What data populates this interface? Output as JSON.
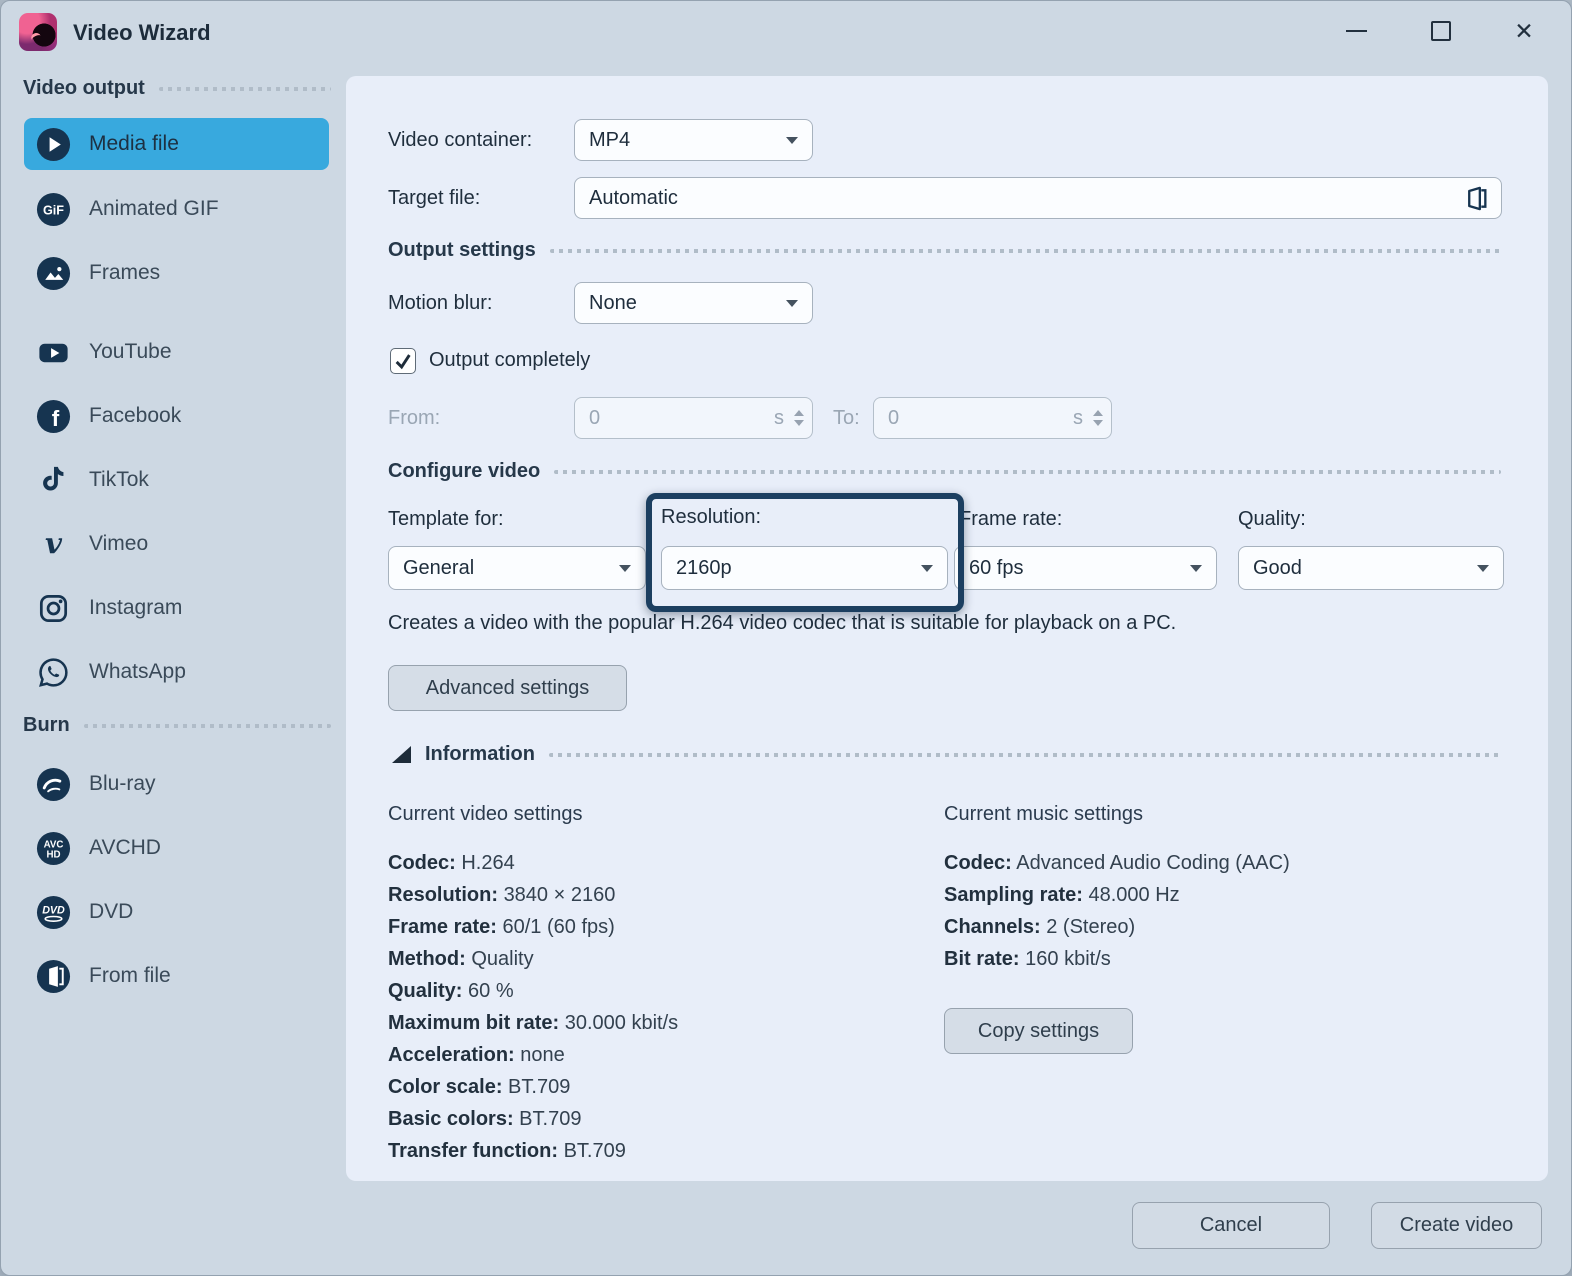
{
  "window": {
    "title": "Video Wizard",
    "controls": {
      "minimize": "minimize",
      "maximize": "maximize",
      "close": "✕"
    }
  },
  "colors": {
    "accent": "#38a9de",
    "icon_navy": "#163450",
    "highlight_border": "#1c3f60",
    "panel_bg": "#e8eef9",
    "window_bg": "#cdd8e3"
  },
  "sidebar": {
    "video_output_label": "Video output",
    "burn_label": "Burn",
    "items": [
      {
        "label": "Media file",
        "icon": "play-circle-icon",
        "selected": true
      },
      {
        "label": "Animated GIF",
        "icon": "gif-icon"
      },
      {
        "label": "Frames",
        "icon": "frames-icon"
      },
      {
        "label": "YouTube",
        "icon": "youtube-icon"
      },
      {
        "label": "Facebook",
        "icon": "facebook-icon"
      },
      {
        "label": "TikTok",
        "icon": "tiktok-icon"
      },
      {
        "label": "Vimeo",
        "icon": "vimeo-icon"
      },
      {
        "label": "Instagram",
        "icon": "instagram-icon"
      },
      {
        "label": "WhatsApp",
        "icon": "whatsapp-icon"
      },
      {
        "label": "Blu-ray",
        "icon": "bluray-icon"
      },
      {
        "label": "AVCHD",
        "icon": "avchd-icon"
      },
      {
        "label": "DVD",
        "icon": "dvd-icon"
      },
      {
        "label": "From file",
        "icon": "from-file-icon"
      }
    ]
  },
  "form": {
    "video_container_label": "Video container:",
    "video_container_value": "MP4",
    "target_file_label": "Target file:",
    "target_file_value": "Automatic",
    "output_settings_label": "Output settings",
    "motion_blur_label": "Motion blur:",
    "motion_blur_value": "None",
    "output_completely_label": "Output completely",
    "output_completely_checked": true,
    "from_label": "From:",
    "from_value": "0",
    "from_unit": "s",
    "to_label": "To:",
    "to_value": "0",
    "to_unit": "s",
    "configure_video_label": "Configure video",
    "template_label": "Template for:",
    "template_value": "General",
    "resolution_label": "Resolution:",
    "resolution_value": "2160p",
    "frame_rate_label": "Frame rate:",
    "frame_rate_value": "60 fps",
    "quality_label": "Quality:",
    "quality_value": "Good",
    "description": "Creates a video with the popular H.264 video codec that is suitable for playback on a PC.",
    "advanced_settings_label": "Advanced settings",
    "information_label": "Information"
  },
  "info": {
    "video_title": "Current video settings",
    "video_rows": [
      {
        "k": "Codec:",
        "v": "H.264"
      },
      {
        "k": "Resolution:",
        "v": "3840 × 2160"
      },
      {
        "k": "Frame rate:",
        "v": "60/1 (60 fps)"
      },
      {
        "k": "Method:",
        "v": "Quality"
      },
      {
        "k": "Quality:",
        "v": "60 %"
      },
      {
        "k": "Maximum bit rate:",
        "v": "30.000 kbit/s"
      },
      {
        "k": "Acceleration:",
        "v": "none"
      },
      {
        "k": "Color scale:",
        "v": "BT.709"
      },
      {
        "k": "Basic colors:",
        "v": "BT.709"
      },
      {
        "k": "Transfer function:",
        "v": "BT.709"
      }
    ],
    "music_title": "Current music settings",
    "music_rows": [
      {
        "k": "Codec:",
        "v": "Advanced Audio Coding (AAC)"
      },
      {
        "k": "Sampling rate:",
        "v": "48.000 Hz"
      },
      {
        "k": "Channels:",
        "v": "2 (Stereo)"
      },
      {
        "k": "Bit rate:",
        "v": "160 kbit/s"
      }
    ],
    "copy_settings_label": "Copy settings"
  },
  "footer": {
    "cancel_label": "Cancel",
    "create_label": "Create video"
  }
}
